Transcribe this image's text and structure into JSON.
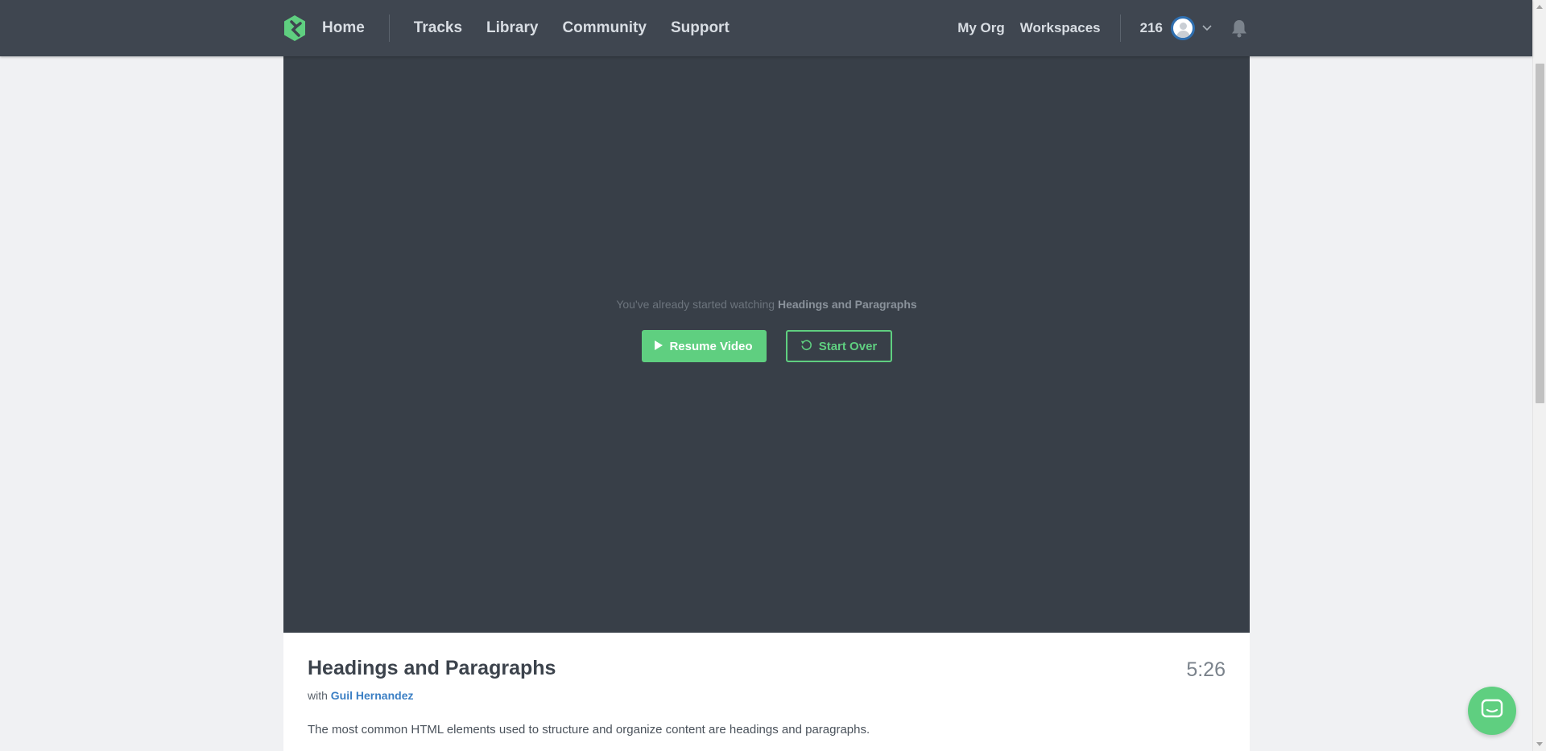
{
  "nav": {
    "home": "Home",
    "links": [
      "Tracks",
      "Library",
      "Community",
      "Support"
    ],
    "my_org": "My Org",
    "workspaces": "Workspaces",
    "points": "216"
  },
  "video": {
    "resume_prefix": "You've already started watching ",
    "resume_title": "Headings and Paragraphs",
    "resume_button": "Resume Video",
    "start_over_button": "Start Over"
  },
  "lesson": {
    "title": "Headings and Paragraphs",
    "duration": "5:26",
    "author_prefix": "with ",
    "author": "Guil Hernandez",
    "description": "The most common HTML elements used to structure and organize content are headings and paragraphs."
  },
  "icons": {
    "logo": "treehouse-logo-icon",
    "chevron": "chevron-down-icon",
    "bell": "bell-icon",
    "play": "play-icon",
    "restart": "restart-icon",
    "chat": "chat-icon"
  },
  "colors": {
    "nav_bg": "#3f4650",
    "video_bg": "#383f48",
    "accent_green": "#5fcf80",
    "link_blue": "#3b7fc4"
  }
}
